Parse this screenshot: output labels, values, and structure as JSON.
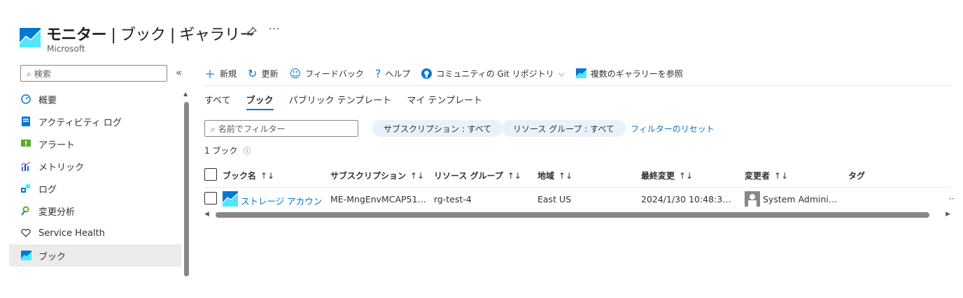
{
  "header": {
    "title_main": "モニター",
    "title_rest": " | ブック | ギャラリー",
    "subtitle": "Microsoft",
    "more": "···"
  },
  "sidebar": {
    "search_placeholder": "検索",
    "collapse": "«",
    "items": [
      {
        "label": "概要",
        "icon": "gauge-icon"
      },
      {
        "label": "アクティビティ ログ",
        "icon": "activity-log-icon"
      },
      {
        "label": "アラート",
        "icon": "alert-icon"
      },
      {
        "label": "メトリック",
        "icon": "metrics-icon"
      },
      {
        "label": "ログ",
        "icon": "logs-icon"
      },
      {
        "label": "変更分析",
        "icon": "change-analysis-icon"
      },
      {
        "label": "Service Health",
        "icon": "heart-icon"
      },
      {
        "label": "ブック",
        "icon": "workbook-icon",
        "active": true
      }
    ]
  },
  "toolbar": {
    "new": "新規",
    "refresh": "更新",
    "feedback": "フィードバック",
    "help": "ヘルプ",
    "community": "コミュニティの Git リポジトリ",
    "browse": "複数のギャラリーを参照"
  },
  "tabs": [
    "すべて",
    "ブック",
    "パブリック テンプレート",
    "マイ テンプレート"
  ],
  "filters": {
    "name_placeholder": "名前でフィルター",
    "subscription": "サブスクリプション : すべて",
    "resource_group": "リソース グループ : すべて",
    "reset": "フィルターのリセット"
  },
  "count_text": "1 ブック",
  "table": {
    "headers": {
      "name": "ブック名",
      "subscription": "サブスクリプション",
      "resource_group": "リソース グループ",
      "region": "地域",
      "last_modified": "最終変更",
      "modified_by": "変更者",
      "tags": "タグ"
    },
    "sort_glyph": "↑↓",
    "rows": [
      {
        "name": "ストレージ アカウント…",
        "subscription": "ME-MngEnvMCAP51…",
        "resource_group": "rg-test-4",
        "region": "East US",
        "last_modified": "2024/1/30 10:48:3…",
        "modified_by": "System Admini…",
        "tags": ""
      }
    ]
  },
  "colors": {
    "accent": "#0078d4",
    "pill_bg": "#e8f2fb",
    "active_bg": "#edebe9"
  }
}
